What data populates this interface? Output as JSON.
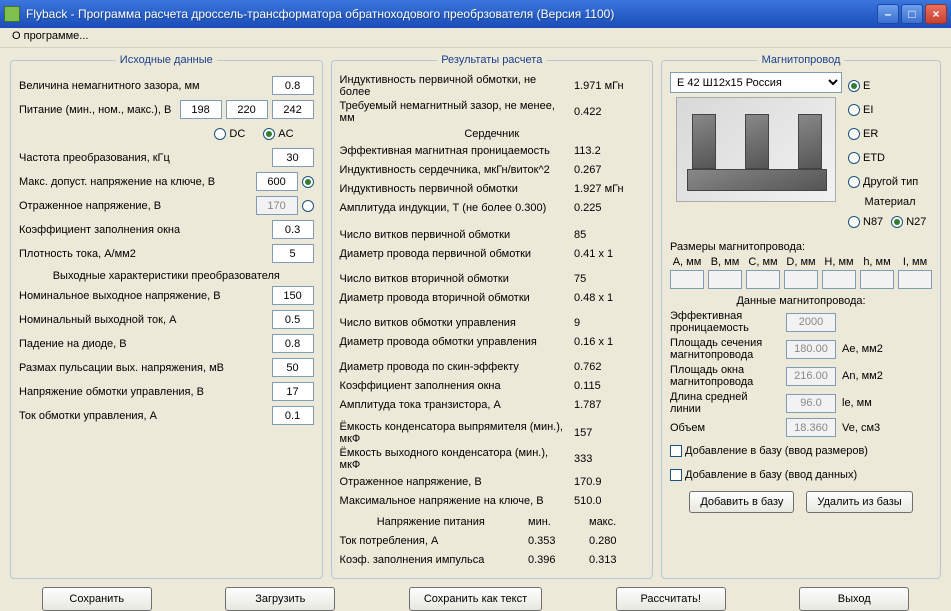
{
  "window": {
    "title": "Flyback - Программа расчета дроссель-трансформатора обратноходового преобрзователя (Версия 1100)"
  },
  "menu": {
    "about": "О программе..."
  },
  "groups": {
    "input": "Исходные данные",
    "results": "Результаты расчета",
    "core": "Магнитопровод"
  },
  "input": {
    "gap_label": "Величина немагнитного зазора, мм",
    "gap": "0.8",
    "supply_label": "Питание (мин., ном., макс.), В",
    "supply_min": "198",
    "supply_nom": "220",
    "supply_max": "242",
    "dc": "DC",
    "ac": "AC",
    "freq_label": "Частота преобразования, кГц",
    "freq": "30",
    "vsw_label": "Макс. допуст. напряжение на ключе, В",
    "vsw": "600",
    "vref_label": "Отраженное напряжение, В",
    "vref": "170",
    "kfill_label": "Коэффициент заполнения окна",
    "kfill": "0.3",
    "jdens_label": "Плотность тока, А/мм2",
    "jdens": "5",
    "out_heading": "Выходные характеристики преобразователя",
    "vout_label": "Номинальное выходное напряжение, В",
    "vout": "150",
    "iout_label": "Номинальный выходной ток, А",
    "iout": "0.5",
    "vdiode_label": "Падение на диоде, В",
    "vdiode": "0.8",
    "ripple_label": "Размах пульсации вых. напряжения, мВ",
    "ripple": "50",
    "vctrl_label": "Напряжение обмотки управления, В",
    "vctrl": "17",
    "ictrl_label": "Ток обмотки управления, А",
    "ictrl": "0.1"
  },
  "results": {
    "lprim_label": "Индуктивность первичной обмотки, не более",
    "lprim": "1.971 мГн",
    "gapreq_label": "Требуемый немагнитный зазор, не менее, мм",
    "gapreq": "0.422",
    "core_heading": "Сердечник",
    "mu_label": "Эффективная магнитная проницаемость",
    "mu": "113.2",
    "al_label": "Индуктивность сердечника, мкГн/виток^2",
    "al": "0.267",
    "lprim2_label": "Индуктивность первичной обмотки",
    "lprim2": "1.927 мГн",
    "bmax_label": "Амплитуда индукции, Т      (не более 0.300)",
    "bmax": "0.225",
    "nprim_label": "Число витков первичной обмотки",
    "nprim": "85",
    "dprim_label": "Диаметр провода первичной обмотки",
    "dprim": "0.41 x 1",
    "nsec_label": "Число витков вторичной обмотки",
    "nsec": "75",
    "dsec_label": "Диаметр провода вторичной обмотки",
    "dsec": "0.48 x 1",
    "nctrl_label": "Число витков обмотки управления",
    "nctrl": "9",
    "dctrl_label": "Диаметр провода обмотки управления",
    "dctrl": "0.16 x 1",
    "dskin_label": "Диаметр провода по скин-эффекту",
    "dskin": "0.762",
    "kwin_label": "Коэффициент заполнения окна",
    "kwin": "0.115",
    "itran_label": "Амплитуда тока транзистора, А",
    "itran": "1.787",
    "crect_label": "Ёмкость конденсатора выпрямителя (мин.), мкФ",
    "crect": "157",
    "cout_label": "Ёмкость выходного конденсатора (мин.), мкФ",
    "cout": "333",
    "vrefl_label": "Отраженное напряжение, В",
    "vrefl": "170.9",
    "vswmax_label": "Максимальное напряжение на ключе, В",
    "vswmax": "510.0",
    "psup_heading": "Напряжение питания",
    "col_min": "мин.",
    "col_max": "макс.",
    "icons_label": "Ток потребления, А",
    "icons_min": "0.353",
    "icons_max": "0.280",
    "duty_label": "Коэф. заполнения импульса",
    "duty_min": "0.396",
    "duty_max": "0.313"
  },
  "core": {
    "select": "E 42 Ш12x15 Россия",
    "shape_E": "E",
    "shape_EI": "EI",
    "shape_ER": "ER",
    "shape_ETD": "ETD",
    "shape_other": "Другой тип",
    "material_label": "Материал",
    "mat_N87": "N87",
    "mat_N27": "N27",
    "dims_heading": "Размеры магнитопровода:",
    "dimA": "A, мм",
    "dimB": "B, мм",
    "dimC": "C, мм",
    "dimD": "D, мм",
    "dimHh": "H, мм",
    "dimh": "h, мм",
    "dimI": "I, мм",
    "dimAval": "",
    "dimBval": "",
    "dimCval": "",
    "dimDval": "",
    "dimHval": "",
    "dimhval": "",
    "dimIval": "",
    "data_heading": "Данные магнитопровода:",
    "mu_label": "Эффективная проницаемость",
    "mu": "2000",
    "ae_label": "Площадь сечения магнитопровода",
    "ae": "180.00",
    "ae_u": "Ae, мм2",
    "an_label": "Площадь окна магнитопровода",
    "an": "216.00",
    "an_u": "An, мм2",
    "le_label": "Длина средней линии",
    "le": "96.0",
    "le_u": "le, мм",
    "ve_label": "Объем",
    "ve": "18.360",
    "ve_u": "Ve, см3",
    "add_dims": "Добавление в базу (ввод размеров)",
    "add_data": "Добавление в базу (ввод данных)",
    "btn_add": "Добавить в базу",
    "btn_del": "Удалить из базы"
  },
  "buttons": {
    "save": "Сохранить",
    "load": "Загрузить",
    "save_txt": "Сохранить как текст",
    "calc": "Рассчитать!",
    "exit": "Выход"
  }
}
